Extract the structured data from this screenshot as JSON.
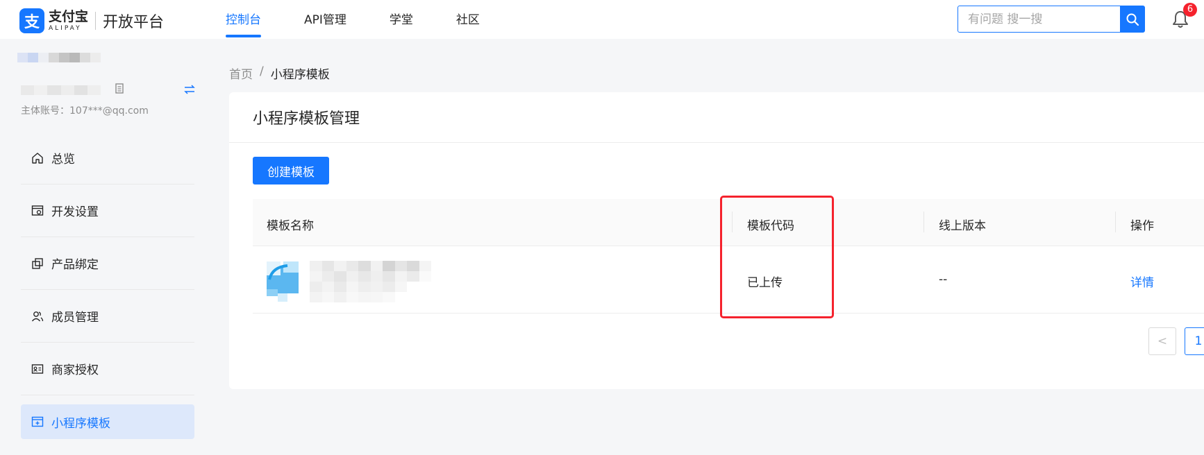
{
  "brand": {
    "cn": "支付宝",
    "en": "ALIPAY",
    "mark": "支",
    "platform": "开放平台"
  },
  "topnav": {
    "items": [
      {
        "label": "控制台",
        "active": true
      },
      {
        "label": "API管理",
        "active": false
      },
      {
        "label": "学堂",
        "active": false
      },
      {
        "label": "社区",
        "active": false
      }
    ]
  },
  "search": {
    "placeholder": "有问题 搜一搜",
    "value": "",
    "icon": "search-icon"
  },
  "notifications": {
    "icon": "bell-icon",
    "count": "6"
  },
  "sidebar": {
    "account": {
      "main_account": "主体账号：107***@qq.com"
    },
    "menu": [
      {
        "label": "总览",
        "icon": "home-icon",
        "active": false
      },
      {
        "label": "开发设置",
        "icon": "settings-window-icon",
        "active": false
      },
      {
        "label": "产品绑定",
        "icon": "link-icon",
        "active": false
      },
      {
        "label": "成员管理",
        "icon": "users-icon",
        "active": false
      },
      {
        "label": "商家授权",
        "icon": "id-card-icon",
        "active": false
      },
      {
        "label": "小程序模板",
        "icon": "template-icon",
        "active": true
      }
    ]
  },
  "breadcrumb": {
    "home": "首页",
    "separator": "/",
    "current": "小程序模板"
  },
  "card": {
    "title": "小程序模板管理",
    "create_button": "创建模板"
  },
  "table": {
    "columns": [
      "模板名称",
      "模板代码",
      "线上版本",
      "操作"
    ],
    "rows": [
      {
        "name": "",
        "code": "已上传",
        "online_version": "--",
        "action": "详情"
      }
    ]
  },
  "pagination": {
    "prev": "<",
    "current_page": "1"
  },
  "colors": {
    "accent": "#1677ff",
    "highlight": "#f5222d",
    "active_menu_bg": "#dde8fb"
  }
}
